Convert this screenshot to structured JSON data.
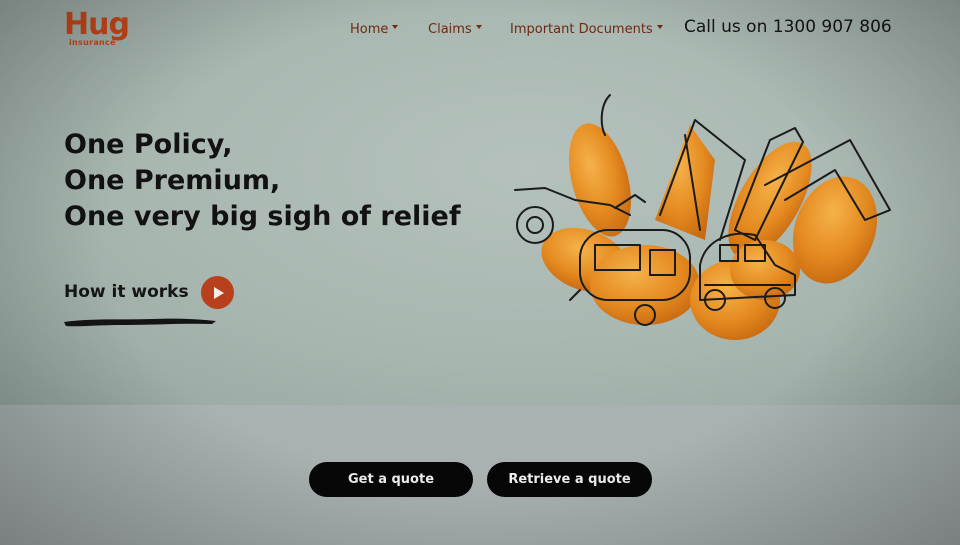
{
  "brand": {
    "logo_text": "Hug",
    "logo_subtext": "insurance",
    "accent": "#c5461a"
  },
  "nav": {
    "items": [
      {
        "label": "Home"
      },
      {
        "label": "Claims"
      },
      {
        "label": "Important Documents"
      }
    ],
    "phone": "Call us on 1300 907 806"
  },
  "hero": {
    "headline": [
      "One Policy,",
      "One Premium,",
      "One very big sigh of relief"
    ],
    "how_it_works": "How it works",
    "play_icon": "play-icon",
    "illustration_icon": "orange-vehicles-illustration"
  },
  "actions": {
    "get_quote": "Get a quote",
    "retrieve_quote": "Retrieve a quote"
  }
}
